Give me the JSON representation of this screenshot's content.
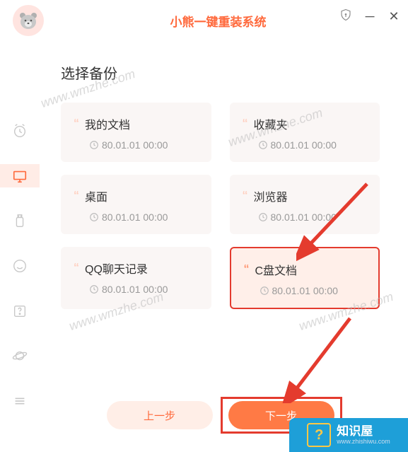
{
  "app": {
    "title": "小熊一键重装系统"
  },
  "page": {
    "title": "选择备份"
  },
  "cards": [
    {
      "title": "我的文档",
      "time": "80.01.01 00:00",
      "selected": false
    },
    {
      "title": "收藏夹",
      "time": "80.01.01 00:00",
      "selected": false
    },
    {
      "title": "桌面",
      "time": "80.01.01 00:00",
      "selected": false
    },
    {
      "title": "浏览器",
      "time": "80.01.01 00:00",
      "selected": false
    },
    {
      "title": "QQ聊天记录",
      "time": "80.01.01 00:00",
      "selected": false
    },
    {
      "title": "C盘文档",
      "time": "80.01.01 00:00",
      "selected": true
    }
  ],
  "buttons": {
    "prev": "上一步",
    "next": "下一步"
  },
  "watermark": {
    "text": "www.wmzhe.com"
  },
  "footer": {
    "brand_cn": "知识屋",
    "brand_en": "www.zhishiwu.com"
  }
}
